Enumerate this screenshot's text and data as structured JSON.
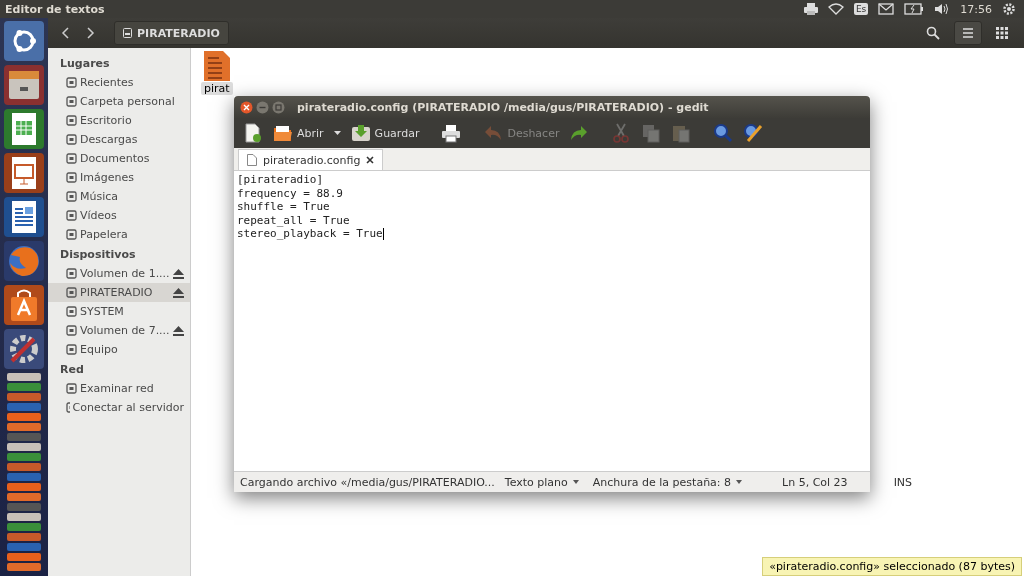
{
  "top_panel": {
    "title": "Editor de textos",
    "keyboard": "Es",
    "time": "17:56"
  },
  "file_manager": {
    "path_button": "PIRATERADIO",
    "sidebar": [
      {
        "heading": "Lugares",
        "items": [
          {
            "label": "Recientes",
            "selected": false,
            "eject": false
          },
          {
            "label": "Carpeta personal",
            "selected": false,
            "eject": false
          },
          {
            "label": "Escritorio",
            "selected": false,
            "eject": false
          },
          {
            "label": "Descargas",
            "selected": false,
            "eject": false
          },
          {
            "label": "Documentos",
            "selected": false,
            "eject": false
          },
          {
            "label": "Imágenes",
            "selected": false,
            "eject": false
          },
          {
            "label": "Música",
            "selected": false,
            "eject": false
          },
          {
            "label": "Vídeos",
            "selected": false,
            "eject": false
          },
          {
            "label": "Papelera",
            "selected": false,
            "eject": false
          }
        ]
      },
      {
        "heading": "Dispositivos",
        "items": [
          {
            "label": "Volumen de 1....",
            "selected": false,
            "eject": true
          },
          {
            "label": "PIRATERADIO",
            "selected": true,
            "eject": true
          },
          {
            "label": "SYSTEM",
            "selected": false,
            "eject": false
          },
          {
            "label": "Volumen de 7....",
            "selected": false,
            "eject": true
          },
          {
            "label": "Equipo",
            "selected": false,
            "eject": false
          }
        ]
      },
      {
        "heading": "Red",
        "items": [
          {
            "label": "Examinar red",
            "selected": false,
            "eject": false
          },
          {
            "label": "Conectar al servidor",
            "selected": false,
            "eject": false
          }
        ]
      }
    ],
    "file": {
      "label": "pirat"
    },
    "status": "«pirateradio.config» seleccionado  (87 bytes)"
  },
  "editor": {
    "title": "pirateradio.config (PIRATERADIO /media/gus/PIRATERADIO) - gedit",
    "toolbar": [
      {
        "kind": "new",
        "disabled": false
      },
      {
        "kind": "open",
        "label": "Abrir",
        "disabled": false
      },
      {
        "kind": "save",
        "label": "Guardar",
        "disabled": false
      },
      {
        "kind": "print",
        "disabled": false
      },
      {
        "kind": "undo",
        "label": "Deshacer",
        "disabled": true
      },
      {
        "kind": "redo",
        "disabled": false
      },
      {
        "kind": "cut",
        "disabled": true
      },
      {
        "kind": "copy",
        "disabled": true
      },
      {
        "kind": "paste",
        "disabled": true
      },
      {
        "kind": "find",
        "disabled": false
      },
      {
        "kind": "replace",
        "disabled": false
      }
    ],
    "tab": {
      "label": "pirateradio.config",
      "selected": true
    },
    "lines": [
      "[pirateradio]",
      "frequency = 88.9",
      "shuffle = True",
      "repeat_all = True",
      "stereo_playback = True"
    ],
    "status_bar": {
      "message": "Cargando archivo «/media/gus/PIRATERADIO...",
      "language": "Texto plano",
      "tab_width": "Anchura de la pestaña: 8",
      "position": "Ln 5, Col 23",
      "mode": "INS"
    }
  }
}
